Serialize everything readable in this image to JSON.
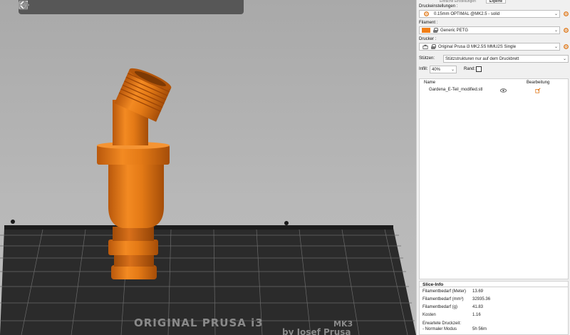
{
  "panel": {
    "tabs": [
      "Einfache Einstellungen",
      "Experte"
    ],
    "print_settings_label": "Druckeinstellungen :",
    "print_settings_value": "0.15mm OPTIMAL @MK2.5 - solid",
    "filament_label": "Filament :",
    "filament_value": "Generic PETG",
    "filament_color": "#f07e16",
    "printer_label": "Drucker :",
    "printer_value": "Original Prusa i3 MK2.5S MMU2S Single",
    "supports_label": "Stützen:",
    "supports_value": "Stützstrukturen nur auf dem Druckbrett",
    "infill_label": "Infill:",
    "infill_value": "40%",
    "brim_label": "Rand:",
    "brim_checked": false
  },
  "object_list": {
    "col_name": "Name",
    "col_edit": "Bearbeitung",
    "rows": [
      {
        "name": "Gardena_E-Teil_modified.stl"
      }
    ]
  },
  "slice_info": {
    "title": "Slice-Info",
    "rows": [
      {
        "label": "Filamentbedarf (Meter)",
        "value": "13.69"
      },
      {
        "label": "Filamentbedarf (mm³)",
        "value": "32935.36"
      },
      {
        "label": "Filamentbedarf (g)",
        "value": "41.83"
      },
      {
        "label": "Kosten",
        "value": "1.16"
      }
    ],
    "estimated_time_label": "Erwartete Druckzeit:",
    "normal_mode_label": "- Normaler Modus",
    "normal_mode_value": "5h 56m"
  },
  "bed": {
    "brand_line1": "ORIGINAL PRUSA i3",
    "brand_mk": "MK3",
    "brand_line2": "by Josef Prusa"
  },
  "colors": {
    "model_orange": "#e47a16",
    "bed_dark": "#2a2a2a",
    "toolbar": "#3a3a3a"
  }
}
